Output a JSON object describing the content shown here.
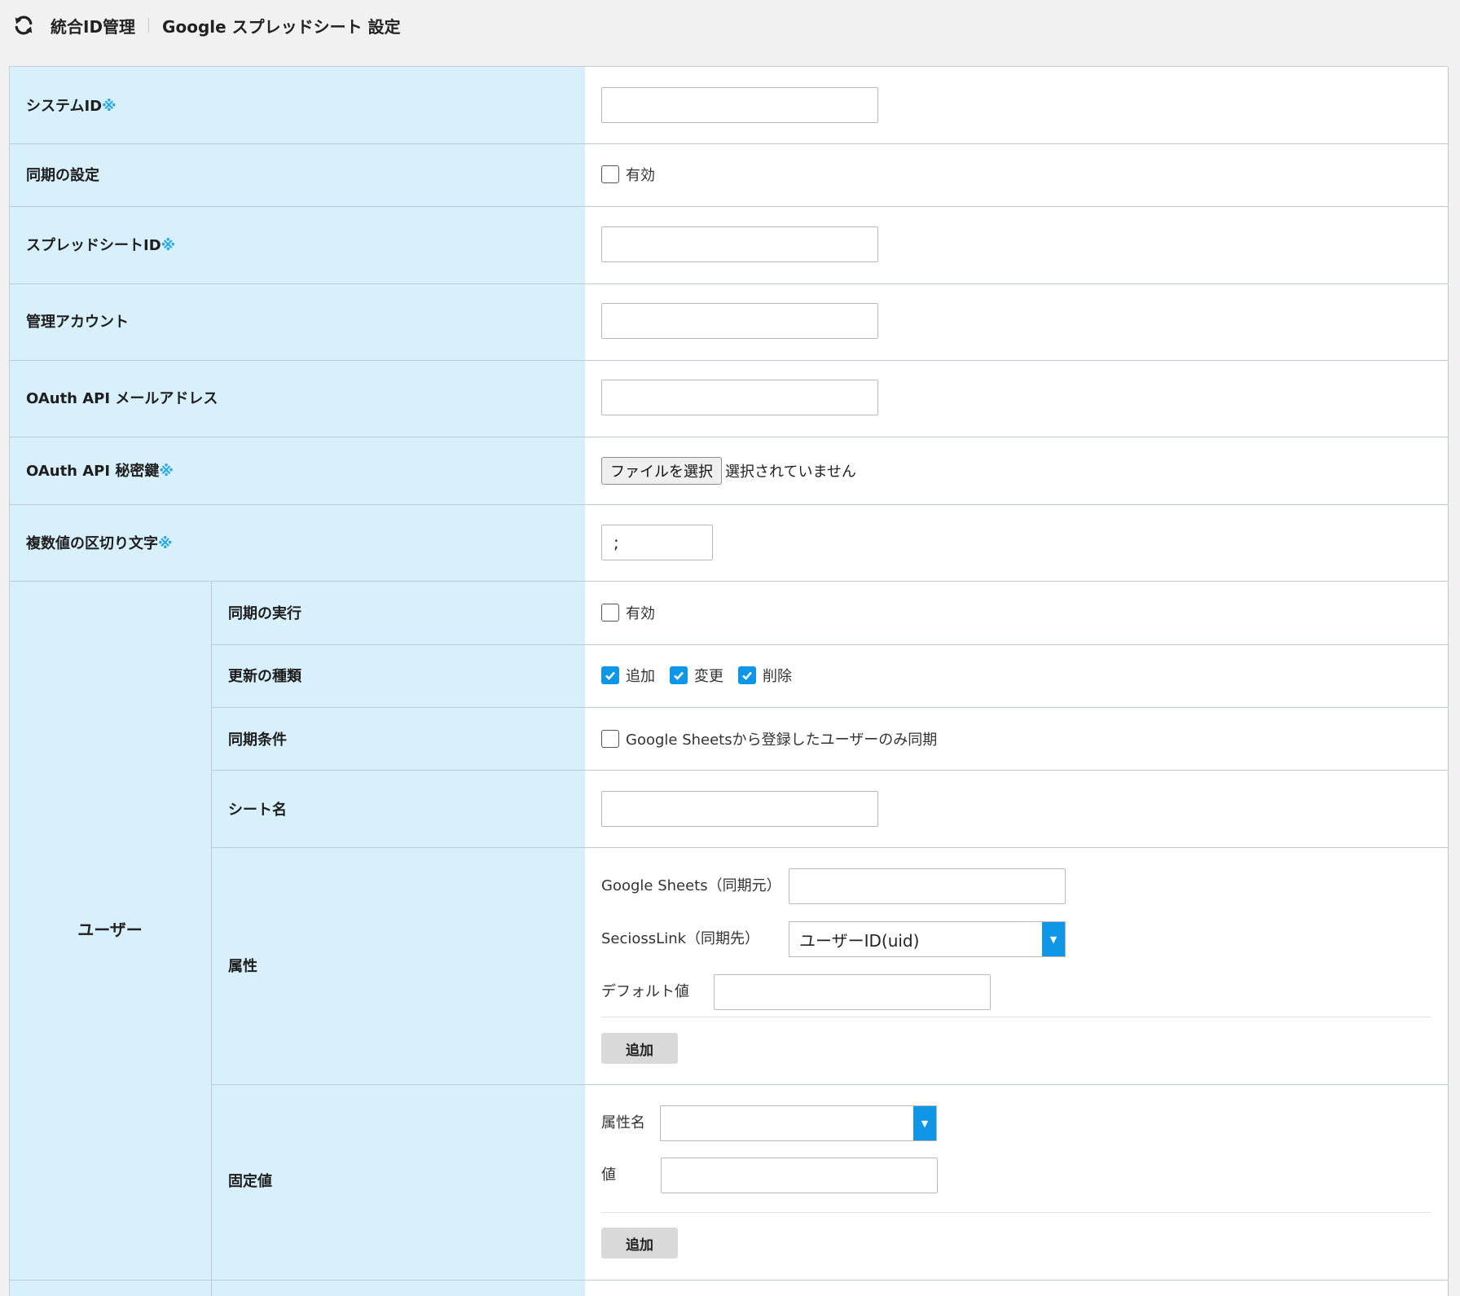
{
  "breadcrumb": {
    "icon": "refresh-icon",
    "section": "統合ID管理",
    "page": "Google スプレッドシート 設定"
  },
  "required_mark": "※",
  "colors": {
    "label_bg": "#d8f0fc",
    "accent": "#0f96e6",
    "required": "#29a8e0"
  },
  "form": {
    "system_id": {
      "label": "システムID",
      "value": ""
    },
    "sync_setting": {
      "label": "同期の設定",
      "checkbox_label": "有効",
      "checked": false
    },
    "spreadsheet_id": {
      "label": "スプレッドシートID",
      "value": ""
    },
    "admin_account": {
      "label": "管理アカウント",
      "value": ""
    },
    "oauth_email": {
      "label": "OAuth API メールアドレス",
      "value": ""
    },
    "oauth_key": {
      "label": "OAuth API 秘密鍵",
      "button": "ファイルを選択",
      "status": "選択されていません"
    },
    "delimiter": {
      "label": "複数値の区切り文字",
      "value": ";"
    }
  },
  "user_group": {
    "label": "ユーザー",
    "sync_run": {
      "label": "同期の実行",
      "checkbox_label": "有効",
      "checked": false
    },
    "update_types": {
      "label": "更新の種類",
      "options": [
        {
          "label": "追加",
          "checked": true
        },
        {
          "label": "変更",
          "checked": true
        },
        {
          "label": "削除",
          "checked": true
        }
      ]
    },
    "sync_condition": {
      "label": "同期条件",
      "checkbox_label": "Google Sheetsから登録したユーザーのみ同期",
      "checked": false
    },
    "sheet_name": {
      "label": "シート名",
      "value": ""
    },
    "attributes": {
      "label": "属性",
      "source_label": "Google Sheets（同期元）",
      "source_value": "",
      "target_label": "SeciossLink（同期先）",
      "target_value": "ユーザーID(uid)",
      "default_label": "デフォルト値",
      "default_value": "",
      "add_button": "追加"
    },
    "fixed_values": {
      "label": "固定値",
      "attr_name_label": "属性名",
      "attr_name_value": "",
      "value_label": "値",
      "value_value": "",
      "add_button": "追加"
    }
  }
}
